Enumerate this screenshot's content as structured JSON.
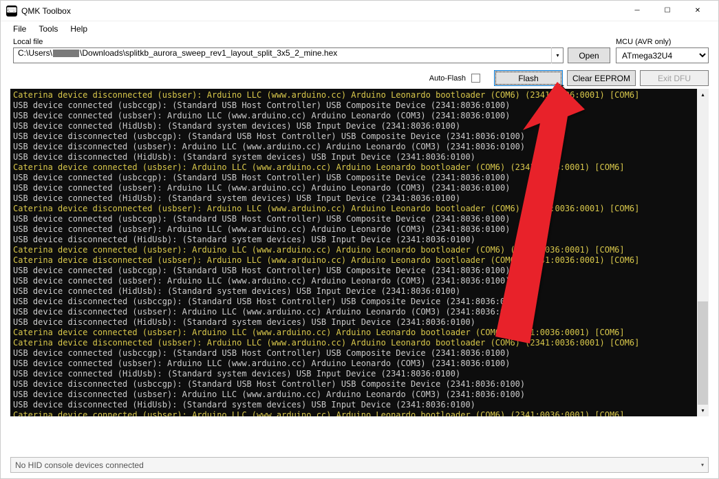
{
  "window": {
    "title": "QMK Toolbox"
  },
  "menu": {
    "file": "File",
    "tools": "Tools",
    "help": "Help"
  },
  "fileRow": {
    "localFileLabel": "Local file",
    "filePathPrefix": "C:\\Users\\",
    "filePathSuffix": "\\Downloads\\splitkb_aurora_sweep_rev1_layout_split_3x5_2_mine.hex",
    "openLabel": "Open",
    "mcuLabel": "MCU (AVR only)",
    "mcuValue": "ATmega32U4"
  },
  "actions": {
    "autoFlashLabel": "Auto-Flash",
    "flashLabel": "Flash",
    "clearEepromLabel": "Clear EEPROM",
    "exitDfuLabel": "Exit DFU"
  },
  "status": {
    "text": "No HID console devices connected"
  },
  "console": {
    "lines": [
      {
        "c": "yellow",
        "t": "Caterina device disconnected (usbser): Arduino LLC (www.arduino.cc) Arduino Leonardo bootloader (COM6) (2341:0036:0001) [COM6]"
      },
      {
        "c": "white",
        "t": "USB device connected (usbccgp): (Standard USB Host Controller) USB Composite Device (2341:8036:0100)"
      },
      {
        "c": "white",
        "t": "USB device connected (usbser): Arduino LLC (www.arduino.cc) Arduino Leonardo (COM3) (2341:8036:0100)"
      },
      {
        "c": "white",
        "t": "USB device connected (HidUsb): (Standard system devices) USB Input Device (2341:8036:0100)"
      },
      {
        "c": "white",
        "t": "USB device disconnected (usbccgp): (Standard USB Host Controller) USB Composite Device (2341:8036:0100)"
      },
      {
        "c": "white",
        "t": "USB device disconnected (usbser): Arduino LLC (www.arduino.cc) Arduino Leonardo (COM3) (2341:8036:0100)"
      },
      {
        "c": "white",
        "t": "USB device disconnected (HidUsb): (Standard system devices) USB Input Device (2341:8036:0100)"
      },
      {
        "c": "yellow",
        "t": "Caterina device connected (usbser): Arduino LLC (www.arduino.cc) Arduino Leonardo bootloader (COM6) (2341:0036:0001) [COM6]"
      },
      {
        "c": "white",
        "t": "USB device connected (usbccgp): (Standard USB Host Controller) USB Composite Device (2341:8036:0100)"
      },
      {
        "c": "white",
        "t": "USB device connected (usbser): Arduino LLC (www.arduino.cc) Arduino Leonardo (COM3) (2341:8036:0100)"
      },
      {
        "c": "white",
        "t": "USB device connected (HidUsb): (Standard system devices) USB Input Device (2341:8036:0100)"
      },
      {
        "c": "yellow",
        "t": "Caterina device disconnected (usbser): Arduino LLC (www.arduino.cc) Arduino Leonardo bootloader (COM6) (2341:0036:0001) [COM6]"
      },
      {
        "c": "white",
        "t": "USB device connected (usbccgp): (Standard USB Host Controller) USB Composite Device (2341:8036:0100)"
      },
      {
        "c": "white",
        "t": "USB device connected (usbser): Arduino LLC (www.arduino.cc) Arduino Leonardo (COM3) (2341:8036:0100)"
      },
      {
        "c": "white",
        "t": "USB device disconnected (HidUsb): (Standard system devices) USB Input Device (2341:8036:0100)"
      },
      {
        "c": "yellow",
        "t": "Caterina device connected (usbser): Arduino LLC (www.arduino.cc) Arduino Leonardo bootloader (COM6) (2341:0036:0001) [COM6]"
      },
      {
        "c": "yellow",
        "t": "Caterina device disconnected (usbser): Arduino LLC (www.arduino.cc) Arduino Leonardo bootloader (COM6) (2341:0036:0001) [COM6]"
      },
      {
        "c": "white",
        "t": "USB device connected (usbccgp): (Standard USB Host Controller) USB Composite Device (2341:8036:0100)"
      },
      {
        "c": "white",
        "t": "USB device connected (usbser): Arduino LLC (www.arduino.cc) Arduino Leonardo (COM3) (2341:8036:0100)"
      },
      {
        "c": "white",
        "t": "USB device connected (HidUsb): (Standard system devices) USB Input Device (2341:8036:0100)"
      },
      {
        "c": "white",
        "t": "USB device disconnected (usbccgp): (Standard USB Host Controller) USB Composite Device (2341:8036:0100)"
      },
      {
        "c": "white",
        "t": "USB device disconnected (usbser): Arduino LLC (www.arduino.cc) Arduino Leonardo (COM3) (2341:8036:0100)"
      },
      {
        "c": "white",
        "t": "USB device disconnected (HidUsb): (Standard system devices) USB Input Device (2341:8036:0100)"
      },
      {
        "c": "yellow",
        "t": "Caterina device connected (usbser): Arduino LLC (www.arduino.cc) Arduino Leonardo bootloader (COM6) (2341:0036:0001) [COM6]"
      },
      {
        "c": "yellow",
        "t": "Caterina device disconnected (usbser): Arduino LLC (www.arduino.cc) Arduino Leonardo bootloader (COM6) (2341:0036:0001) [COM6]"
      },
      {
        "c": "white",
        "t": "USB device connected (usbccgp): (Standard USB Host Controller) USB Composite Device (2341:8036:0100)"
      },
      {
        "c": "white",
        "t": "USB device connected (usbser): Arduino LLC (www.arduino.cc) Arduino Leonardo (COM3) (2341:8036:0100)"
      },
      {
        "c": "white",
        "t": "USB device connected (HidUsb): (Standard system devices) USB Input Device (2341:8036:0100)"
      },
      {
        "c": "white",
        "t": "USB device disconnected (usbccgp): (Standard USB Host Controller) USB Composite Device (2341:8036:0100)"
      },
      {
        "c": "white",
        "t": "USB device disconnected (usbser): Arduino LLC (www.arduino.cc) Arduino Leonardo (COM3) (2341:8036:0100)"
      },
      {
        "c": "white",
        "t": "USB device disconnected (HidUsb): (Standard system devices) USB Input Device (2341:8036:0100)"
      },
      {
        "c": "yellow",
        "t": "Caterina device connected (usbser): Arduino LLC (www.arduino.cc) Arduino Leonardo bootloader (COM6) (2341:0036:0001) [COM6]"
      }
    ]
  }
}
